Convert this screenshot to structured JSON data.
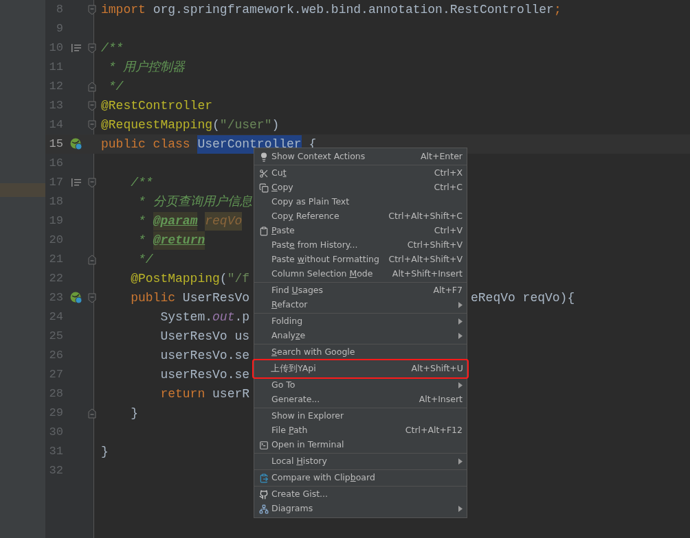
{
  "editor": {
    "lines": [
      {
        "number": "8",
        "gutter": [
          {
            "kind": "fold_start"
          }
        ],
        "tokens": [
          {
            "text": "import ",
            "kind": "keyword"
          },
          {
            "text": "org.springframework.web.bind.annotation.RestController",
            "kind": "plain"
          },
          {
            "text": ";",
            "kind": "keyword"
          }
        ]
      },
      {
        "number": "9"
      },
      {
        "number": "10",
        "gutter": [
          {
            "kind": "doc"
          },
          {
            "kind": "fold_start"
          }
        ],
        "tokens": [
          {
            "text": "/**",
            "kind": "doc"
          }
        ]
      },
      {
        "number": "11",
        "tokens": [
          {
            "text": " * 用户控制器",
            "kind": "doc"
          }
        ]
      },
      {
        "number": "12",
        "gutter": [
          {
            "kind": "fold_end"
          }
        ],
        "tokens": [
          {
            "text": " */",
            "kind": "doc"
          }
        ]
      },
      {
        "number": "13",
        "gutter": [
          {
            "kind": "fold_start"
          }
        ],
        "tokens": [
          {
            "text": "@RestController",
            "kind": "annotation"
          }
        ]
      },
      {
        "number": "14",
        "gutter": [
          {
            "kind": "fold_start"
          }
        ],
        "tokens": [
          {
            "text": "@RequestMapping",
            "kind": "annotation"
          },
          {
            "text": "(",
            "kind": "plain"
          },
          {
            "text": "\"/user\"",
            "kind": "string"
          },
          {
            "text": ")",
            "kind": "plain"
          }
        ]
      },
      {
        "number": "15",
        "current": true,
        "gutter": [
          {
            "kind": "bean"
          }
        ],
        "tokens": [
          {
            "text": "public class ",
            "kind": "keyword"
          },
          {
            "text": "UserController",
            "kind": "selected"
          },
          {
            "text": " {",
            "kind": "plain"
          }
        ]
      },
      {
        "number": "16"
      },
      {
        "number": "17",
        "gutter": [
          {
            "kind": "doc"
          },
          {
            "kind": "fold_start"
          }
        ],
        "tokens": [
          {
            "text": "    /**",
            "kind": "doc"
          }
        ]
      },
      {
        "number": "18",
        "tokens": [
          {
            "text": "     * 分页查询用户信息",
            "kind": "doc"
          }
        ]
      },
      {
        "number": "19",
        "tokens": [
          {
            "text": "     * ",
            "kind": "doc"
          },
          {
            "text": "@param",
            "kind": "doctag"
          },
          {
            "text": "reqVo",
            "kind": "param"
          }
        ]
      },
      {
        "number": "20",
        "tokens": [
          {
            "text": "     * ",
            "kind": "doc"
          },
          {
            "text": "@return",
            "kind": "doctag"
          }
        ]
      },
      {
        "number": "21",
        "gutter": [
          {
            "kind": "fold_end"
          }
        ],
        "tokens": [
          {
            "text": "     */",
            "kind": "doc"
          }
        ]
      },
      {
        "number": "22",
        "tokens": [
          {
            "text": "    @PostMapping",
            "kind": "annotation"
          },
          {
            "text": "(",
            "kind": "plain"
          },
          {
            "text": "\"/f",
            "kind": "string"
          }
        ]
      },
      {
        "number": "23",
        "gutter": [
          {
            "kind": "bean"
          },
          {
            "kind": "fold_start"
          }
        ],
        "tokens": [
          {
            "text": "    public ",
            "kind": "keyword"
          },
          {
            "text": "UserResVo",
            "kind": "plain"
          }
        ],
        "tail": [
          {
            "text": "eReqVo reqVo){",
            "kind": "plain"
          }
        ]
      },
      {
        "number": "24",
        "tokens": [
          {
            "text": "        System.",
            "kind": "plain"
          },
          {
            "text": "out",
            "kind": "static"
          },
          {
            "text": ".p",
            "kind": "plain"
          }
        ]
      },
      {
        "number": "25",
        "tokens": [
          {
            "text": "        UserResVo us",
            "kind": "plain"
          }
        ]
      },
      {
        "number": "26",
        "tokens": [
          {
            "text": "        userResVo.se",
            "kind": "plain"
          }
        ]
      },
      {
        "number": "27",
        "tokens": [
          {
            "text": "        userResVo.se",
            "kind": "plain"
          }
        ]
      },
      {
        "number": "28",
        "tokens": [
          {
            "text": "        return ",
            "kind": "keyword"
          },
          {
            "text": "userR",
            "kind": "plain"
          }
        ]
      },
      {
        "number": "29",
        "gutter": [
          {
            "kind": "fold_end"
          }
        ],
        "tokens": [
          {
            "text": "    }",
            "kind": "plain"
          }
        ]
      },
      {
        "number": "30"
      },
      {
        "number": "31",
        "tokens": [
          {
            "text": "}",
            "kind": "plain"
          }
        ]
      },
      {
        "number": "32"
      }
    ]
  },
  "context_menu": {
    "groups": [
      [
        {
          "label": "Show Context Actions",
          "shortcut": "Alt+Enter",
          "submenu": false,
          "outlined": false
        }
      ],
      [
        {
          "label": "Cu",
          "mnemonic": "t",
          "shortcut": "Ctrl+X",
          "submenu": false,
          "outlined": false
        },
        {
          "mnemonic": "C",
          "label_end": "opy",
          "shortcut": "Ctrl+C",
          "submenu": false,
          "outlined": false
        },
        {
          "label": "Copy as Plain Text",
          "submenu": false,
          "outlined": false
        },
        {
          "label": "Cop",
          "mnemonic": "y",
          "label_end": " Reference",
          "shortcut": "Ctrl+Alt+Shift+C",
          "submenu": false,
          "outlined": false
        },
        {
          "mnemonic": "P",
          "label_end": "aste",
          "shortcut": "Ctrl+V",
          "submenu": false,
          "outlined": false
        },
        {
          "label": "Past",
          "mnemonic": "e",
          "label_end": " from History...",
          "shortcut": "Ctrl+Shift+V",
          "submenu": false,
          "outlined": false
        },
        {
          "label": "Paste ",
          "mnemonic": "w",
          "label_end": "ithout Formatting",
          "shortcut": "Ctrl+Alt+Shift+V",
          "submenu": false,
          "outlined": false
        },
        {
          "label": "Column Selection ",
          "mnemonic": "M",
          "label_end": "ode",
          "shortcut": "Alt+Shift+Insert",
          "submenu": false,
          "outlined": false
        }
      ],
      [
        {
          "label": "Find ",
          "mnemonic": "U",
          "label_end": "sages",
          "shortcut": "Alt+F7",
          "submenu": false,
          "outlined": false
        },
        {
          "mnemonic": "R",
          "label_end": "efactor",
          "submenu": true,
          "outlined": false
        }
      ],
      [
        {
          "label": "Folding",
          "submenu": true,
          "outlined": false
        },
        {
          "label": "Analy",
          "mnemonic": "z",
          "label_end": "e",
          "submenu": true,
          "outlined": false
        }
      ],
      [
        {
          "mnemonic": "S",
          "label_end": "earch with Google",
          "submenu": false,
          "outlined": false
        },
        {
          "label": "上传到YApi",
          "shortcut": "Alt+Shift+U",
          "submenu": false,
          "outlined": true
        },
        {
          "label": "Go To",
          "submenu": true,
          "outlined": false
        },
        {
          "label": "Generate...",
          "shortcut": "Alt+Insert",
          "submenu": false,
          "outlined": false
        }
      ],
      [
        {
          "label": "Show in Explorer",
          "submenu": false,
          "outlined": false
        },
        {
          "label": "File ",
          "mnemonic": "P",
          "label_end": "ath",
          "shortcut": "Ctrl+Alt+F12",
          "submenu": false,
          "outlined": false
        },
        {
          "label": "Open in Terminal",
          "submenu": false,
          "outlined": false
        }
      ],
      [
        {
          "label": "Local ",
          "mnemonic": "H",
          "label_end": "istory",
          "submenu": true,
          "outlined": false
        }
      ],
      [
        {
          "label": "Compare with Clip",
          "mnemonic": "b",
          "label_end": "oard",
          "submenu": false,
          "outlined": false
        }
      ],
      [
        {
          "label": "Create Gist...",
          "submenu": false,
          "outlined": false
        },
        {
          "label": "Diagrams",
          "submenu": true,
          "outlined": false
        }
      ]
    ]
  }
}
